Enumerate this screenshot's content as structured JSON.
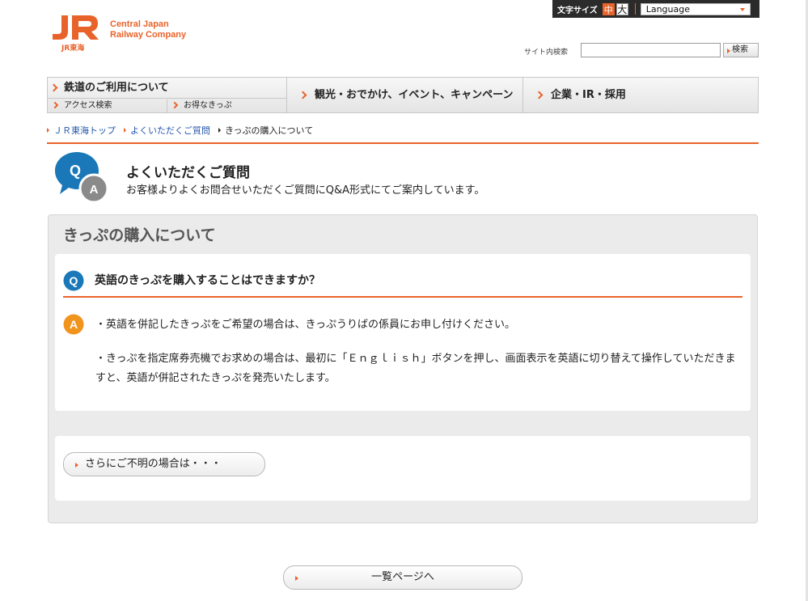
{
  "utility": {
    "font_size_label": "文字サイズ",
    "size_medium": "中",
    "size_large": "大",
    "language_label": "Language"
  },
  "logo": {
    "mark": "JR",
    "line1": "Central Japan",
    "line2": "Railway Company",
    "sub": "JR東海"
  },
  "search": {
    "label": "サイト内検索",
    "value": "",
    "button": "検索"
  },
  "nav": {
    "main1": "鉄道のご利用について",
    "sub1": "アクセス検索",
    "sub2": "お得なきっぷ",
    "main2": "観光・おでかけ、イベント、キャンペーン",
    "main3": "企業・IR・採用"
  },
  "breadcrumb": {
    "home": "ＪＲ東海トップ",
    "faq": "よくいただくご質問",
    "current": "きっぷの購入について"
  },
  "heading": {
    "icon_q": "Q",
    "icon_a": "A",
    "title": "よくいただくご質問",
    "desc": "お客様よりよくお問合せいただくご質問にQ&A形式にてご案内しています。"
  },
  "panel": {
    "title": "きっぷの購入について",
    "question_badge": "Q",
    "question": "英語のきっぷを購入することはできますか？",
    "answer_badge": "A",
    "answer_1": "・英語を併記したきっぷをご希望の場合は、きっぷうりばの係員にお申し付けください。",
    "answer_2": "・きっぷを指定席券売機でお求めの場合は、最初に「Ｅｎｇｌｉｓｈ」ボタンを押し、画面表示を英語に切り替えて操作していただきますと、英語が併記されたきっぷを発売いたします。",
    "more_button": "さらにご不明の場合は・・・"
  },
  "back_button": "一覧ページへ",
  "colors": {
    "brand_orange": "#e8632a",
    "link_blue": "#2255aa",
    "q_blue": "#1a78b8",
    "panel_gray": "#ebebeb"
  }
}
